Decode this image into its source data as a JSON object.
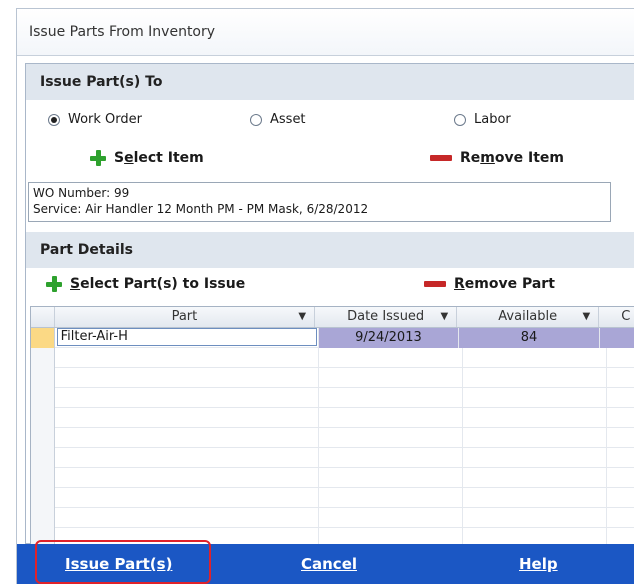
{
  "window": {
    "title": "Issue Parts From Inventory"
  },
  "issue_to": {
    "header": "Issue Part(s) To",
    "options": [
      {
        "label": "Work Order",
        "checked": true
      },
      {
        "label": "Asset",
        "checked": false
      },
      {
        "label": "Labor",
        "checked": false
      }
    ],
    "select_item_prefix": "S",
    "select_item_ul": "e",
    "select_item_rest": "lect Item",
    "remove_item_prefix": "Re",
    "remove_item_ul": "m",
    "remove_item_rest": "ove Item",
    "details_line1": "WO Number:  99",
    "details_line2": "Service:  Air Handler 12 Month PM - PM Mask, 6/28/2012"
  },
  "part_details": {
    "header": "Part Details",
    "select_parts_ul": "S",
    "select_parts_rest": "elect Part(s) to Issue",
    "remove_part_ul": "R",
    "remove_part_rest": "emove Part",
    "columns": [
      "Part",
      "Date Issued",
      "Available",
      "C"
    ],
    "rows": [
      {
        "part": "Filter-Air-H",
        "date_issued": "9/24/2013",
        "available": "84"
      }
    ]
  },
  "footer": {
    "issue_label": "Issue Part(s)",
    "cancel_label": "Cancel",
    "help_label": "Help"
  },
  "colors": {
    "footer": "#1b57c4",
    "selection": "#a9a6d6",
    "highlight": "#e0222a"
  }
}
